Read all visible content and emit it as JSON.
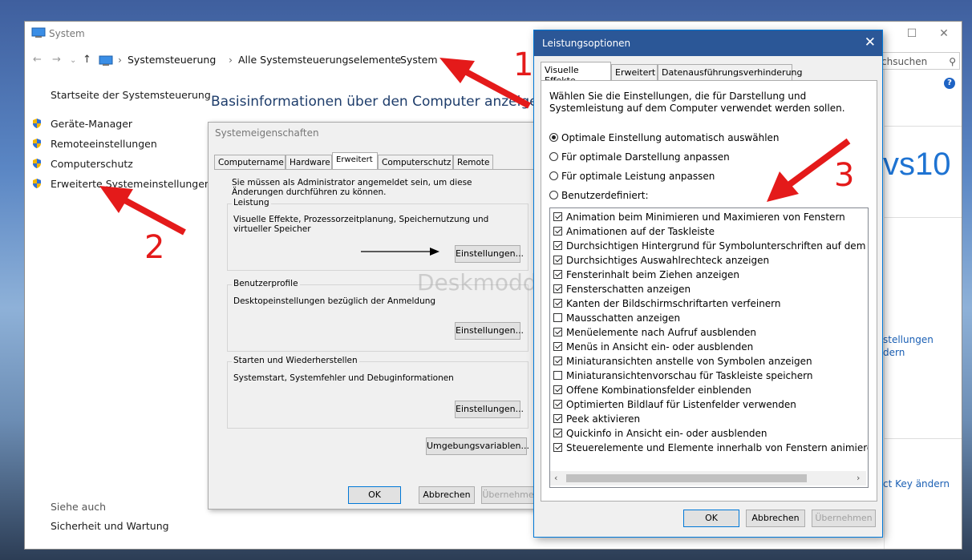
{
  "system_window": {
    "title": "System",
    "controls": {
      "minimize": "–",
      "maximize": "☐",
      "close": "✕"
    },
    "breadcrumb": [
      "Systemsteuerung",
      "Alle Systemsteuerungselemente",
      "System"
    ],
    "search_placeholder": "chsuchen",
    "left_nav": {
      "home": "Startseite der Systemsteuerung",
      "links": [
        "Geräte-Manager",
        "Remoteeinstellungen",
        "Computerschutz",
        "Erweiterte Systemeinstellungen"
      ],
      "see_also_label": "Siehe auch",
      "see_also_link": "Sicherheit und Wartung"
    },
    "heading": "Basisinformationen über den Computer anzeigen",
    "right_fragments": {
      "logo": "vs10",
      "settings1": "stellungen",
      "settings2": "dern",
      "product_key": "ct Key ändern"
    }
  },
  "sysprop": {
    "title": "Systemeigenschaften",
    "tabs": [
      "Computername",
      "Hardware",
      "Erweitert",
      "Computerschutz",
      "Remote"
    ],
    "active_tab": "Erweitert",
    "admin_note": "Sie müssen als Administrator angemeldet sein, um diese Änderungen durchführen zu können.",
    "groups": [
      {
        "label": "Leistung",
        "text": "Visuelle Effekte, Prozessorzeitplanung, Speichernutzung und virtueller Speicher",
        "button": "Einstellungen..."
      },
      {
        "label": "Benutzerprofile",
        "text": "Desktopeinstellungen bezüglich der Anmeldung",
        "button": "Einstellungen..."
      },
      {
        "label": "Starten und Wiederherstellen",
        "text": "Systemstart, Systemfehler und Debuginformationen",
        "button": "Einstellungen..."
      }
    ],
    "env_button": "Umgebungsvariablen...",
    "ok": "OK",
    "cancel": "Abbrechen",
    "apply": "Übernehmen"
  },
  "perf": {
    "title": "Leistungsoptionen",
    "tabs": [
      "Visuelle Effekte",
      "Erweitert",
      "Datenausführungsverhinderung"
    ],
    "active_tab": "Visuelle Effekte",
    "intro": "Wählen Sie die Einstellungen, die für Darstellung und Systemleistung auf dem Computer verwendet werden sollen.",
    "radios": [
      {
        "label": "Optimale Einstellung automatisch auswählen",
        "selected": true
      },
      {
        "label": "Für optimale Darstellung anpassen",
        "selected": false
      },
      {
        "label": "Für optimale Leistung anpassen",
        "selected": false
      },
      {
        "label": "Benutzerdefiniert:",
        "selected": false
      }
    ],
    "effects": [
      {
        "label": "Animation beim Minimieren und Maximieren von Fenstern",
        "checked": true
      },
      {
        "label": "Animationen auf der Taskleiste",
        "checked": true
      },
      {
        "label": "Durchsichtigen Hintergrund für Symbolunterschriften auf dem De",
        "checked": true
      },
      {
        "label": "Durchsichtiges Auswahlrechteck anzeigen",
        "checked": true
      },
      {
        "label": "Fensterinhalt beim Ziehen anzeigen",
        "checked": true
      },
      {
        "label": "Fensterschatten anzeigen",
        "checked": true
      },
      {
        "label": "Kanten der Bildschirmschriftarten verfeinern",
        "checked": true
      },
      {
        "label": "Mausschatten anzeigen",
        "checked": false
      },
      {
        "label": "Menüelemente nach Aufruf ausblenden",
        "checked": true
      },
      {
        "label": "Menüs in Ansicht ein- oder ausblenden",
        "checked": true
      },
      {
        "label": "Miniaturansichten anstelle von Symbolen anzeigen",
        "checked": true
      },
      {
        "label": "Miniaturansichtenvorschau für Taskleiste speichern",
        "checked": false
      },
      {
        "label": "Offene Kombinationsfelder einblenden",
        "checked": true
      },
      {
        "label": "Optimierten Bildlauf für Listenfelder verwenden",
        "checked": true
      },
      {
        "label": "Peek aktivieren",
        "checked": true
      },
      {
        "label": "Quickinfo in Ansicht ein- oder ausblenden",
        "checked": true
      },
      {
        "label": "Steuerelemente und Elemente innerhalb von Fenstern animieren",
        "checked": true
      }
    ],
    "ok": "OK",
    "cancel": "Abbrechen",
    "apply": "Übernehmen"
  },
  "annotations": {
    "n1": "1",
    "n2": "2",
    "n3": "3",
    "watermark": "Deskmodder.de",
    "arrow_color": "#e41a1a"
  }
}
